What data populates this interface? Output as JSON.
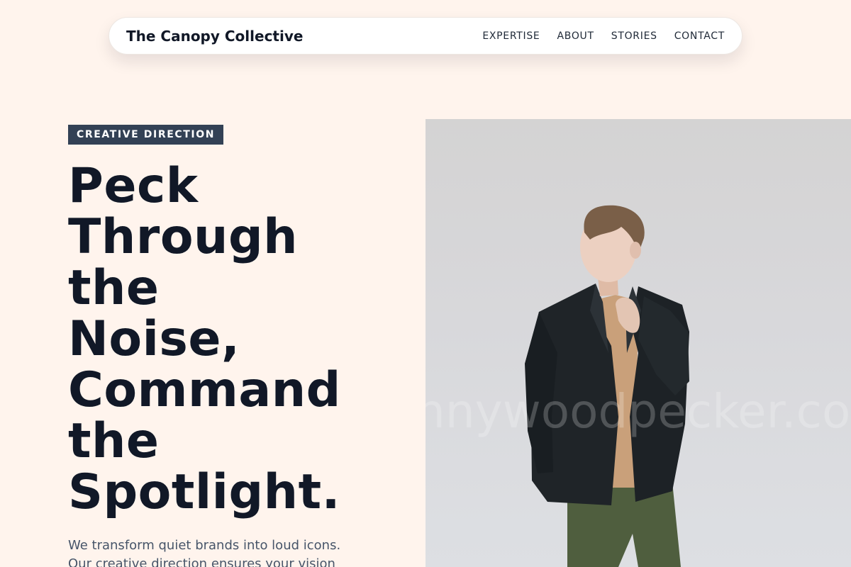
{
  "nav": {
    "brand": "The Canopy Collective",
    "links": [
      "EXPERTISE",
      "ABOUT",
      "STORIES",
      "CONTACT"
    ]
  },
  "hero": {
    "eyebrow": "CREATIVE DIRECTION",
    "headline_lines": [
      "Peck",
      "Through",
      "the",
      "Noise,",
      "Command",
      "the",
      "Spotlight."
    ],
    "intro": "We transform quiet brands into loud icons. Our creative direction ensures your vision",
    "image_watermark": "nnywoodpecker.co"
  },
  "colors": {
    "background": "#fff4ed",
    "eyebrow_bg": "#334155",
    "headline": "#111827",
    "body_text": "#475569"
  }
}
